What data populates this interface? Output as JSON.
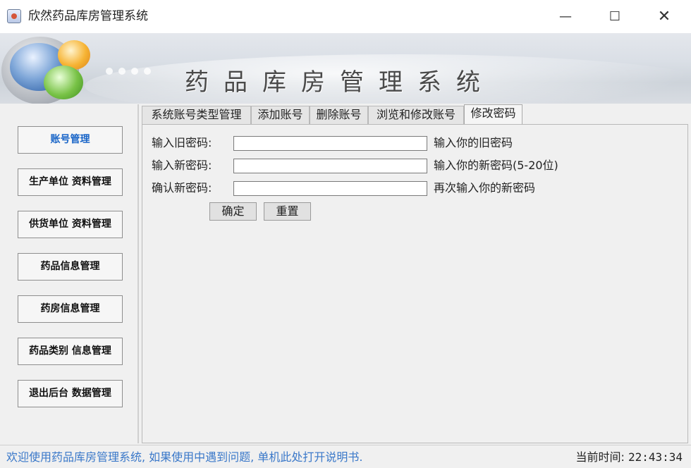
{
  "window": {
    "title": "欣然药品库房管理系统",
    "controls": {
      "minimize": "—",
      "maximize": "☐",
      "close": "✕"
    }
  },
  "banner": {
    "title": "药品库房管理系统"
  },
  "sidebar": {
    "items": [
      {
        "label": "账号管理",
        "active": true
      },
      {
        "label": "生产单位 资料管理"
      },
      {
        "label": "供货单位 资料管理"
      },
      {
        "label": "药品信息管理"
      },
      {
        "label": "药房信息管理"
      },
      {
        "label": "药品类别 信息管理"
      },
      {
        "label": "退出后台 数据管理"
      }
    ]
  },
  "tabs": [
    {
      "label": "系统账号类型管理"
    },
    {
      "label": "添加账号"
    },
    {
      "label": "删除账号"
    },
    {
      "label": "浏览和修改账号"
    },
    {
      "label": "修改密码",
      "selected": true
    }
  ],
  "form": {
    "old_password": {
      "label": "输入旧密码:",
      "value": "",
      "hint": "输入你的旧密码"
    },
    "new_password": {
      "label": "输入新密码:",
      "value": "",
      "hint": "输入你的新密码(5-20位)"
    },
    "confirm_password": {
      "label": "确认新密码:",
      "value": "",
      "hint": "再次输入你的新密码"
    },
    "confirm_button": "确定",
    "reset_button": "重置"
  },
  "status": {
    "message": "欢迎使用药品库房管理系统, 如果使用中遇到问题, 单机此处打开说明书.",
    "time_label": "当前时间:",
    "time_value": "22:43:34"
  },
  "colors": {
    "active_nav": "#1a66c8",
    "status_link": "#3a78c9"
  },
  "icons": {
    "app": "java-app-icon"
  }
}
